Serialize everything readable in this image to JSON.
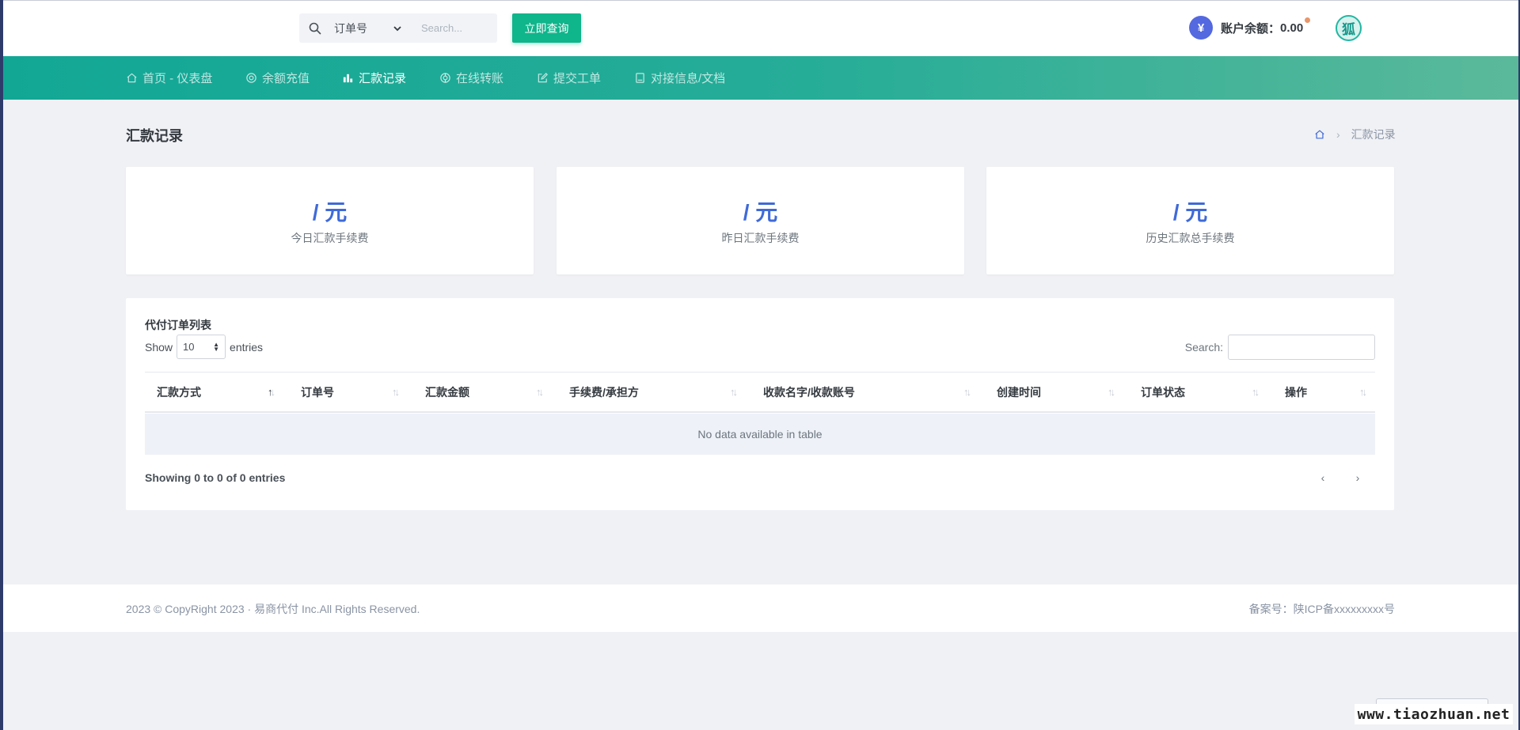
{
  "topbar": {
    "search_type": "订单号",
    "search_placeholder": "Search...",
    "search_button": "立即查询",
    "balance_icon": "¥",
    "balance_label": "账户余额：",
    "balance_value": "0.00",
    "avatar_text": "狐"
  },
  "nav": {
    "items": [
      {
        "label": "首页 - 仪表盘",
        "icon": "home-icon"
      },
      {
        "label": "余额充值",
        "icon": "recharge-icon"
      },
      {
        "label": "汇款记录",
        "icon": "bar-chart-icon",
        "active": true
      },
      {
        "label": "在线转账",
        "icon": "transfer-icon"
      },
      {
        "label": "提交工单",
        "icon": "edit-icon"
      },
      {
        "label": "对接信息/文档",
        "icon": "book-icon"
      }
    ]
  },
  "page": {
    "title": "汇款记录",
    "breadcrumb_current": "汇款记录"
  },
  "stats": [
    {
      "value": "/ 元",
      "label": "今日汇款手续费"
    },
    {
      "value": "/ 元",
      "label": "昨日汇款手续费"
    },
    {
      "value": "/ 元",
      "label": "历史汇款总手续费"
    }
  ],
  "table": {
    "title": "代付订单列表",
    "show_label": "Show",
    "page_length": "10",
    "entries_label": "entries",
    "search_label": "Search:",
    "columns": [
      "汇款方式",
      "订单号",
      "汇款金额",
      "手续费/承担方",
      "收款名字/收款账号",
      "创建时间",
      "订单状态",
      "操作"
    ],
    "empty_message": "No data available in table",
    "info": "Showing 0 to 0 of 0 entries",
    "prev": "‹",
    "next": "›"
  },
  "footer": {
    "copyright": "2023 © CopyRight 2023 · 易商代付 Inc.All Rights Reserved.",
    "icp": "备案号：陕ICP备xxxxxxxxx号"
  },
  "watermark": "www.tiaozhuan.net",
  "colors": {
    "accent": "#0fb58b",
    "nav_start": "#12a795",
    "nav_end": "#5bb99a",
    "stat_value": "#3f6ad8",
    "balance_icon": "#5468e0"
  }
}
